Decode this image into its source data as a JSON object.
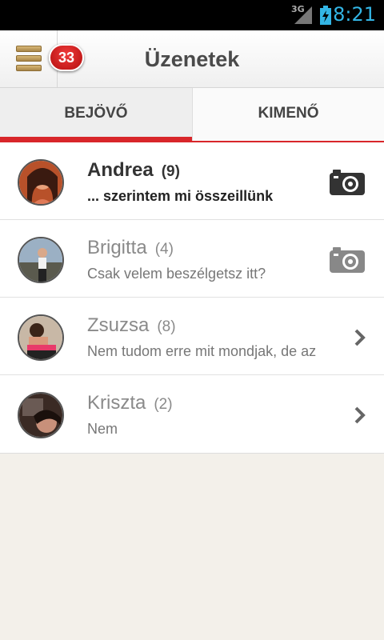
{
  "status_bar": {
    "network": "3G",
    "time": "8:21",
    "battery_icon": "battery-charging-icon",
    "signal_icon": "signal-icon",
    "time_color": "#33b5e5"
  },
  "header": {
    "title": "Üzenetek",
    "badge_count": "33",
    "menu_icon": "menu-icon"
  },
  "tabs": [
    {
      "label": "BEJÖVŐ",
      "active": true
    },
    {
      "label": "KIMENŐ",
      "active": false
    }
  ],
  "colors": {
    "accent": "#d8262a"
  },
  "messages": [
    {
      "name": "Andrea",
      "count": "(9)",
      "preview": "... szerintem mi összeillünk",
      "unread": true,
      "icon": "camera-icon"
    },
    {
      "name": "Brigitta",
      "count": "(4)",
      "preview": "Csak velem beszélgetsz itt?",
      "unread": false,
      "icon": "camera-icon"
    },
    {
      "name": "Zsuzsa",
      "count": "(8)",
      "preview": "Nem tudom erre mit mondjak, de az",
      "unread": false,
      "icon": "chevron-right-icon"
    },
    {
      "name": "Kriszta",
      "count": "(2)",
      "preview": "Nem",
      "unread": false,
      "icon": "chevron-right-icon"
    }
  ]
}
